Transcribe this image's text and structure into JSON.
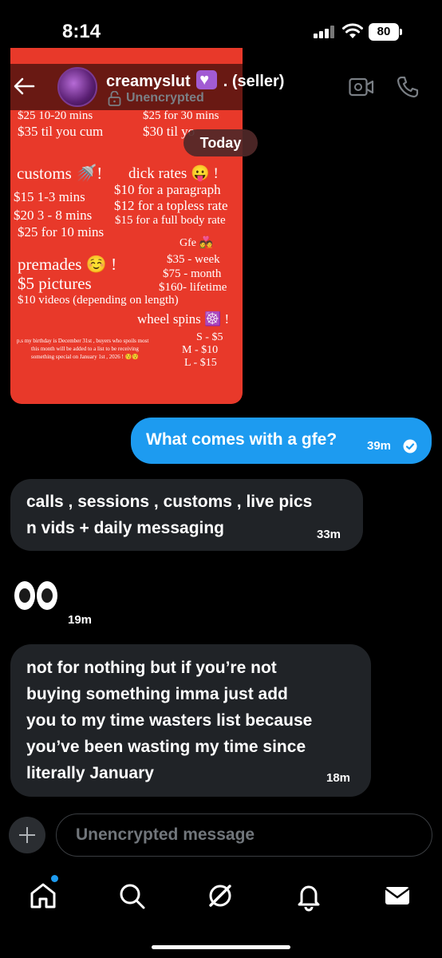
{
  "status_bar": {
    "time": "8:14",
    "battery": "80"
  },
  "header": {
    "contact_name": "creamyslut",
    "contact_suffix": ". (seller)",
    "encryption_status": "Unencrypted"
  },
  "media_card": {
    "top_left_1": "$25 10-20 mins",
    "top_right_1": "$25 for 30 mins",
    "top_left_2": "$35 til you cum",
    "top_right_2": "$30 til yo",
    "customs_heading": "customs 🚿!",
    "customs_1": "$15 1-3 mins",
    "customs_2": "$20 3 - 8 mins",
    "customs_3": "$25 for 10 mins",
    "dick_heading": "dick rates 😛 !",
    "dick_1": "$10 for a paragraph",
    "dick_2": "$12 for a topless rate",
    "dick_3": "$15 for a full body rate",
    "gfe_heading": "Gfe 💑",
    "gfe_1": "$35 - week",
    "gfe_2": "$75 - month",
    "gfe_3": "$160- lifetime",
    "premades_heading": "premades ☺️ !",
    "premades_1": "$5 pictures",
    "premades_2": "$10 videos (depending on length)",
    "wheel_heading": "wheel spins ☸️ !",
    "wheel_1": "S - $5",
    "wheel_2": "M - $10",
    "wheel_3": "L - $15",
    "note_1": "p.s my birthday is December 31st , buyers who spoils most",
    "note_2": "this month will be added to a list to be receiving",
    "note_3": "something special on January 1st , 2026 ! 😚😚"
  },
  "date_separator": "Today",
  "messages": {
    "outgoing_1": {
      "text": "What comes with a gfe?",
      "time": "39m"
    },
    "incoming_1": {
      "line1": "calls , sessions , customs , live pics",
      "line2": "n vids + daily messaging",
      "time": "33m"
    },
    "incoming_2": {
      "emoji": "eyes",
      "time": "19m"
    },
    "incoming_3": {
      "line1": "not for nothing but if you’re not",
      "line2": "buying something imma just add",
      "line3": "you to my time wasters list because",
      "line4": "you’ve been wasting my time since",
      "line5": "literally January",
      "time": "18m"
    }
  },
  "composer": {
    "placeholder": "Unencrypted message"
  },
  "nav": {
    "icons": [
      "home-icon",
      "search-icon",
      "grok-icon",
      "notifications-icon",
      "messages-icon"
    ],
    "accent": "#1d9bf0"
  },
  "colors": {
    "outgoing_bubble": "#1d9bf0",
    "incoming_bubble": "#202327",
    "card": "#e8392a",
    "badge": "#a25bd3"
  }
}
